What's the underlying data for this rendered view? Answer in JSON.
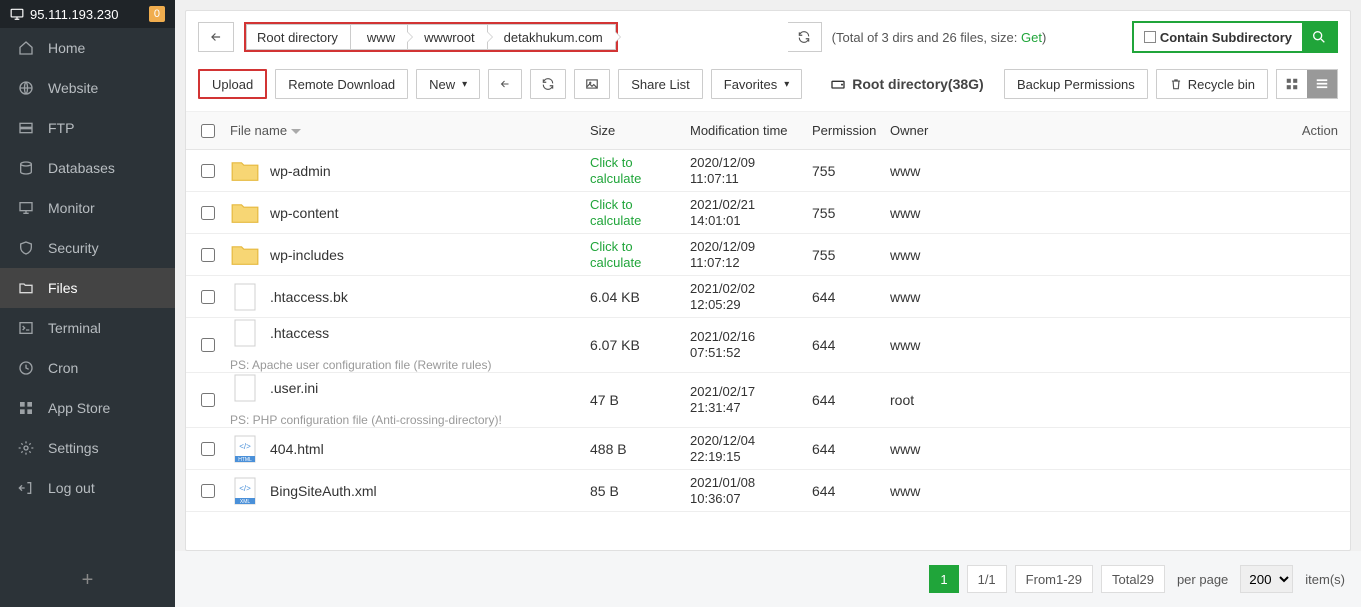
{
  "sidebar": {
    "ip": "95.111.193.230",
    "badge": "0",
    "items": [
      {
        "label": "Home",
        "icon": "home"
      },
      {
        "label": "Website",
        "icon": "globe"
      },
      {
        "label": "FTP",
        "icon": "ftp"
      },
      {
        "label": "Databases",
        "icon": "db"
      },
      {
        "label": "Monitor",
        "icon": "monitor"
      },
      {
        "label": "Security",
        "icon": "shield"
      },
      {
        "label": "Files",
        "icon": "folder"
      },
      {
        "label": "Terminal",
        "icon": "terminal"
      },
      {
        "label": "Cron",
        "icon": "cron"
      },
      {
        "label": "App Store",
        "icon": "apps"
      },
      {
        "label": "Settings",
        "icon": "gear"
      },
      {
        "label": "Log out",
        "icon": "logout"
      }
    ],
    "active_index": 6
  },
  "breadcrumb": {
    "root_label": "Root directory",
    "segments": [
      "www",
      "wwwroot",
      "detakhukum.com"
    ]
  },
  "summary_prefix": "(Total of 3 dirs and 26 files, size: ",
  "summary_get": "Get",
  "summary_suffix": ")",
  "search": {
    "label": "Contain Subdirectory"
  },
  "toolbar": {
    "upload": "Upload",
    "remote_download": "Remote Download",
    "new": "New",
    "share_list": "Share List",
    "favorites": "Favorites",
    "root_directory": "Root directory(38G)",
    "backup_permissions": "Backup Permissions",
    "recycle_bin": "Recycle bin"
  },
  "columns": {
    "name": "File name",
    "size": "Size",
    "mod": "Modification time",
    "perm": "Permission",
    "owner": "Owner",
    "action": "Action"
  },
  "click_to_calculate": "Click to\ncalculate",
  "files": [
    {
      "name": "wp-admin",
      "type": "folder",
      "size": null,
      "mod": "2020/12/09\n11:07:11",
      "perm": "755",
      "owner": "www"
    },
    {
      "name": "wp-content",
      "type": "folder",
      "size": null,
      "mod": "2021/02/21\n14:01:01",
      "perm": "755",
      "owner": "www"
    },
    {
      "name": "wp-includes",
      "type": "folder",
      "size": null,
      "mod": "2020/12/09\n11:07:12",
      "perm": "755",
      "owner": "www"
    },
    {
      "name": ".htaccess.bk",
      "type": "file",
      "size": "6.04 KB",
      "mod": "2021/02/02\n12:05:29",
      "perm": "644",
      "owner": "www"
    },
    {
      "name": ".htaccess",
      "type": "file",
      "size": "6.07 KB",
      "mod": "2021/02/16\n07:51:52",
      "perm": "644",
      "owner": "www",
      "ps": "PS: Apache user configuration file (Rewrite rules)"
    },
    {
      "name": ".user.ini",
      "type": "file",
      "size": "47 B",
      "mod": "2021/02/17\n21:31:47",
      "perm": "644",
      "owner": "root",
      "ps": "PS: PHP configuration file (Anti-crossing-directory)!"
    },
    {
      "name": "404.html",
      "type": "html",
      "size": "488 B",
      "mod": "2020/12/04\n22:19:15",
      "perm": "644",
      "owner": "www"
    },
    {
      "name": "BingSiteAuth.xml",
      "type": "xml",
      "size": "85 B",
      "mod": "2021/01/08\n10:36:07",
      "perm": "644",
      "owner": "www"
    }
  ],
  "footer": {
    "page_active": "1",
    "page_total": "1/1",
    "from": "From1-29",
    "total": "Total29",
    "per_page_label": "per page",
    "per_page_value": "200",
    "items_label": "item(s)"
  }
}
